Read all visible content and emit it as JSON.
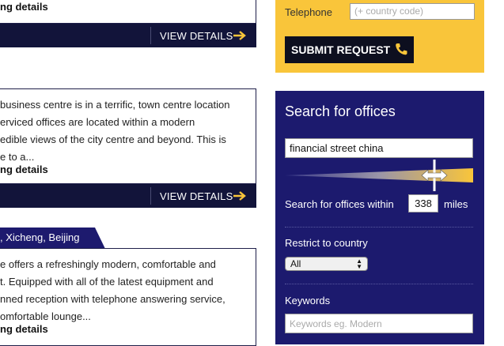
{
  "listings": [
    {
      "title": "ng details",
      "view_details": "VIEW DETAILS"
    },
    {
      "lines": [
        "business centre is in a terrific, town centre location",
        "erviced offices are located within a modern",
        "edible views of the city centre and beyond. This is",
        "e to a..."
      ],
      "title": "ng details",
      "view_details": "VIEW DETAILS"
    },
    {
      "tab": ", Xicheng, Beijing",
      "lines": [
        "e offers a refreshingly modern, comfortable and",
        "t. Equipped with all of the latest equipment and",
        "nned reception with telephone answering service,",
        "omfortable lounge..."
      ],
      "title": "ng details"
    }
  ],
  "request": {
    "telephone_label": "Telephone",
    "telephone_placeholder": "(+ country code)",
    "submit_label": "SUBMIT REQUEST"
  },
  "search": {
    "heading": "Search for offices",
    "query": "financial street china",
    "within_label": "Search for offices within",
    "miles_value": "338",
    "miles_label": "miles",
    "country_label": "Restrict to country",
    "country_selected": "All",
    "keywords_label": "Keywords",
    "keywords_placeholder": "Keywords eg. Modern"
  },
  "colors": {
    "navy": "#1c1a6e",
    "bar": "#12143a",
    "yellow": "#f9c53a",
    "arrow": "#f9c53a"
  },
  "icons": {
    "arrow": "arrow-right-icon",
    "phone": "phone-icon",
    "slider_handle": "resize-handle-icon"
  }
}
